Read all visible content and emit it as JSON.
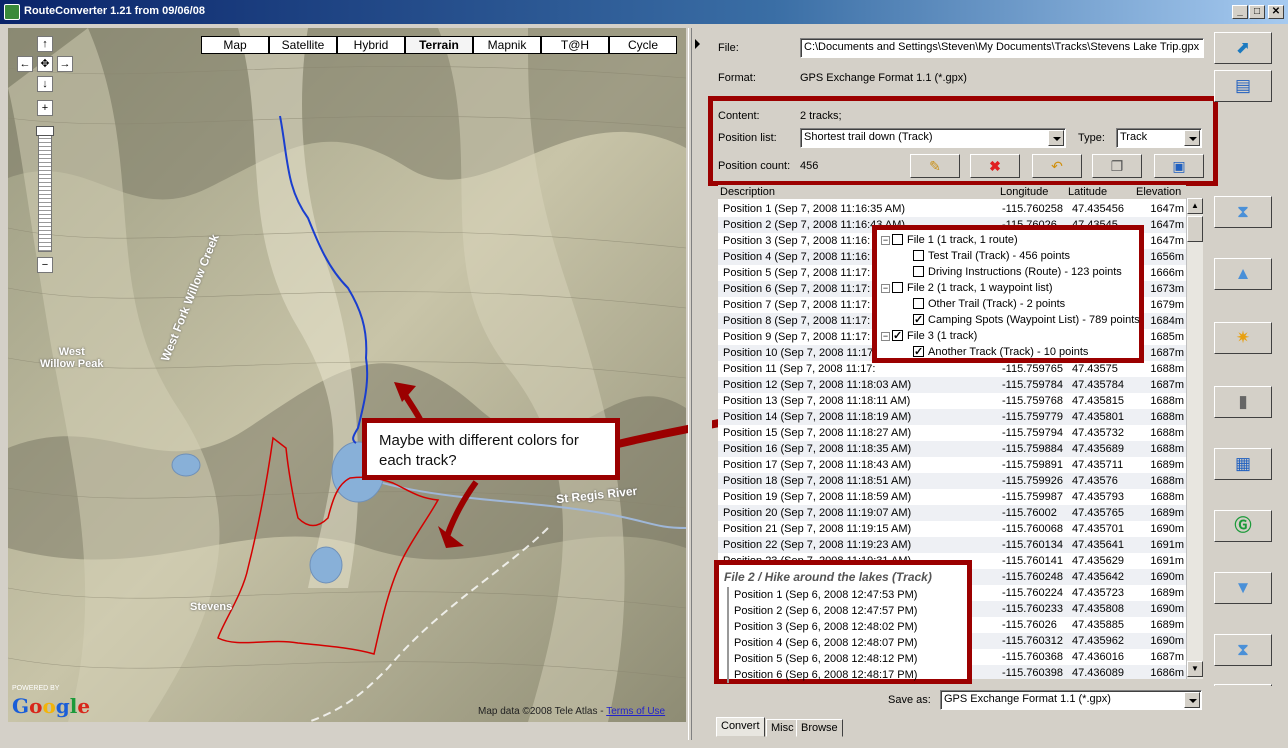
{
  "window": {
    "title": "RouteConverter 1.21 from 09/06/08",
    "minimize": "_",
    "maximize": "□",
    "close": "✕"
  },
  "map": {
    "types": [
      "Map",
      "Satellite",
      "Hybrid",
      "Terrain",
      "Mapnik",
      "T@H",
      "Cycle"
    ],
    "selected_type": "Terrain",
    "nav": {
      "up": "↑",
      "left": "←",
      "center": "✥",
      "right": "→",
      "down": "↓",
      "zoom_in": "+",
      "zoom_out": "−"
    },
    "labels": {
      "west_fork": "West Fork Willow Creek",
      "west_willow_peak": "West\nWillow Peak",
      "st_regis": "St Regis River",
      "stevens": "Stevens"
    },
    "copyright_prefix": "Map data ©2008 Tele Atlas - ",
    "copyright_link": "Terms of Use",
    "powered_by": "POWERED BY",
    "google": "Google"
  },
  "panel": {
    "file_label": "File:",
    "file_value": "C:\\Documents and Settings\\Steven\\My Documents\\Tracks\\Stevens Lake Trip.gpx",
    "format_label": "Format:",
    "format_value": "GPS Exchange Format 1.1 (*.gpx)",
    "content_label": "Content:",
    "content_value": "2 tracks;",
    "position_list_label": "Position list:",
    "position_list_value": "Shortest trail down (Track)",
    "type_label": "Type:",
    "type_value": "Track",
    "position_count_label": "Position count:",
    "position_count_value": "456",
    "save_as_label": "Save as:",
    "save_as_value": "GPS Exchange Format 1.1 (*.gpx)"
  },
  "table": {
    "headers": [
      "Description",
      "Longitude",
      "Latitude",
      "Elevation"
    ],
    "rows": [
      [
        "Position 1 (Sep 7, 2008 11:16:35 AM)",
        "-115.760258",
        "47.435456",
        "1647m"
      ],
      [
        "Position 2 (Sep 7, 2008 11:16:43 AM)",
        "-115.76026",
        "47.43545",
        "1647m"
      ],
      [
        "Position 3 (Sep 7, 2008 11:16:",
        "",
        "",
        "1647m"
      ],
      [
        "Position 4 (Sep 7, 2008 11:16:",
        "",
        "",
        "1656m"
      ],
      [
        "Position 5 (Sep 7, 2008 11:17:",
        "",
        "",
        "1666m"
      ],
      [
        "Position 6 (Sep 7, 2008 11:17:",
        "",
        "",
        "1673m"
      ],
      [
        "Position 7 (Sep 7, 2008 11:17:",
        "",
        "",
        "1679m"
      ],
      [
        "Position 8 (Sep 7, 2008 11:17:",
        "",
        "",
        "1684m"
      ],
      [
        "Position 9 (Sep 7, 2008 11:17:",
        "",
        "",
        "1685m"
      ],
      [
        "Position 10 (Sep 7, 2008 11:17:",
        "",
        "",
        "1687m"
      ],
      [
        "Position 11 (Sep 7, 2008 11:17:",
        "-115.759765",
        "47.43575",
        "1688m"
      ],
      [
        "Position 12 (Sep 7, 2008 11:18:03 AM)",
        "-115.759784",
        "47.435784",
        "1687m"
      ],
      [
        "Position 13 (Sep 7, 2008 11:18:11 AM)",
        "-115.759768",
        "47.435815",
        "1688m"
      ],
      [
        "Position 14 (Sep 7, 2008 11:18:19 AM)",
        "-115.759779",
        "47.435801",
        "1688m"
      ],
      [
        "Position 15 (Sep 7, 2008 11:18:27 AM)",
        "-115.759794",
        "47.435732",
        "1688m"
      ],
      [
        "Position 16 (Sep 7, 2008 11:18:35 AM)",
        "-115.759884",
        "47.435689",
        "1688m"
      ],
      [
        "Position 17 (Sep 7, 2008 11:18:43 AM)",
        "-115.759891",
        "47.435711",
        "1689m"
      ],
      [
        "Position 18 (Sep 7, 2008 11:18:51 AM)",
        "-115.759926",
        "47.43576",
        "1688m"
      ],
      [
        "Position 19 (Sep 7, 2008 11:18:59 AM)",
        "-115.759987",
        "47.435793",
        "1688m"
      ],
      [
        "Position 20 (Sep 7, 2008 11:19:07 AM)",
        "-115.76002",
        "47.435765",
        "1689m"
      ],
      [
        "Position 21 (Sep 7, 2008 11:19:15 AM)",
        "-115.760068",
        "47.435701",
        "1690m"
      ],
      [
        "Position 22 (Sep 7, 2008 11:19:23 AM)",
        "-115.760134",
        "47.435641",
        "1691m"
      ],
      [
        "Position 23 (Sep 7, 2008 11:19:31 AM)",
        "-115.760141",
        "47.435629",
        "1691m"
      ],
      [
        "",
        "-115.760248",
        "47.435642",
        "1690m"
      ],
      [
        "",
        "-115.760224",
        "47.435723",
        "1689m"
      ],
      [
        "",
        "-115.760233",
        "47.435808",
        "1690m"
      ],
      [
        "",
        "-115.76026",
        "47.435885",
        "1689m"
      ],
      [
        "",
        "-115.760312",
        "47.435962",
        "1690m"
      ],
      [
        "",
        "-115.760368",
        "47.436016",
        "1687m"
      ],
      [
        "",
        "-115.760398",
        "47.436089",
        "1686m"
      ]
    ]
  },
  "tree": {
    "items": [
      {
        "label": "File 1 (1 track, 1 route)",
        "checked": false,
        "level": 0
      },
      {
        "label": "Test Trail (Track) - 456 points",
        "checked": false,
        "level": 1
      },
      {
        "label": "Driving Instructions (Route) - 123 points",
        "checked": false,
        "level": 1
      },
      {
        "label": "File 2 (1 track, 1 waypoint list)",
        "checked": false,
        "level": 0
      },
      {
        "label": "Other Trail (Track) - 2 points",
        "checked": false,
        "level": 1
      },
      {
        "label": "Camping Spots (Waypoint List) - 789 points",
        "checked": true,
        "level": 1
      },
      {
        "label": "File 3 (1 track)",
        "checked": true,
        "level": 0
      },
      {
        "label": "Another Track (Track) - 10 points",
        "checked": true,
        "level": 1
      }
    ]
  },
  "callout": "Maybe with different colors for each track?",
  "file2": {
    "header": "File 2 / Hike around the lakes (Track)",
    "rows": [
      "Position 1 (Sep 6, 2008 12:47:53 PM)",
      "Position 2 (Sep 6, 2008 12:47:57 PM)",
      "Position 3 (Sep 6, 2008 12:48:02 PM)",
      "Position 4 (Sep 6, 2008 12:48:07 PM)",
      "Position 5 (Sep 6, 2008 12:48:12 PM)",
      "Position 6 (Sep 6, 2008 12:48:17 PM)"
    ]
  },
  "tabs": [
    "Convert",
    "Misc",
    "Browse"
  ],
  "selected_tab": "Convert",
  "toolbar_icons": [
    "pencil-icon",
    "delete-icon",
    "revert-icon",
    "copy-icon",
    "new-icon"
  ],
  "side_icons": [
    "open-file-icon",
    "open-folder-icon",
    "top-icon",
    "up-icon",
    "star-icon",
    "trash-icon",
    "table-icon",
    "g-icon",
    "down-icon",
    "bottom-icon",
    "save-icon"
  ],
  "colors": {
    "annotation_red": "#9b0000",
    "track_blue": "#1a3ecf",
    "track_red": "#d40000"
  }
}
